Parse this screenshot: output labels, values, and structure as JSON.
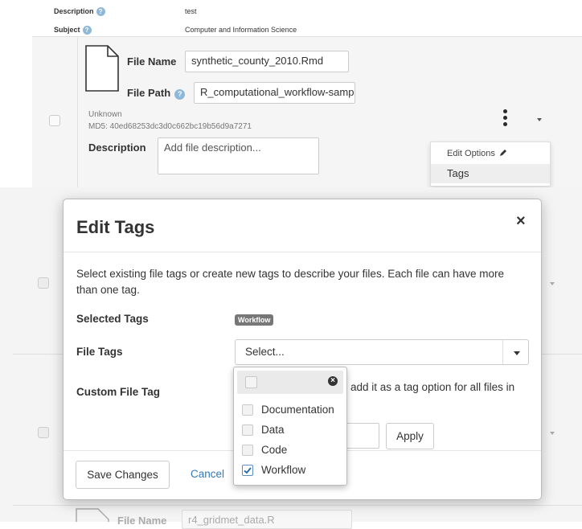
{
  "meta": {
    "description_label": "Description",
    "description_value": "test",
    "subject_label": "Subject",
    "subject_value": "Computer and Information Science",
    "help_glyph": "?"
  },
  "file": {
    "name_label": "File Name",
    "name_value": "synthetic_county_2010.Rmd",
    "path_label": "File Path",
    "path_value": "R_computational_workflow-samp",
    "type": "Unknown",
    "md5": "MD5: 40ed68253dc3d0c662bc19b56d9a7271",
    "description_label": "Description",
    "description_placeholder": "Add file description..."
  },
  "options_menu": {
    "edit_options": "Edit Options",
    "tags": "Tags"
  },
  "modal": {
    "title": "Edit Tags",
    "close_glyph": "×",
    "instructions": "Select existing file tags or create new tags to describe your files. Each file can have more than one tag.",
    "selected_tags_label": "Selected Tags",
    "selected_tags": [
      "Workflow"
    ],
    "file_tags_label": "File Tags",
    "file_tags_placeholder": "Select...",
    "custom_tag_label": "Custom File Tag",
    "custom_tag_help": "add it as a tag option for all files in",
    "apply_label": "Apply",
    "save_label": "Save Changes",
    "cancel_label": "Cancel"
  },
  "tag_dropdown": {
    "options": [
      {
        "label": "Documentation",
        "checked": false
      },
      {
        "label": "Data",
        "checked": false
      },
      {
        "label": "Code",
        "checked": false
      },
      {
        "label": "Workflow",
        "checked": true
      }
    ]
  },
  "next_file": {
    "name_label": "File Name",
    "name_value": "r4_gridmet_data.R"
  },
  "colors": {
    "badge": "#777777",
    "link": "#337ab7",
    "check": "#2b6cb0"
  }
}
